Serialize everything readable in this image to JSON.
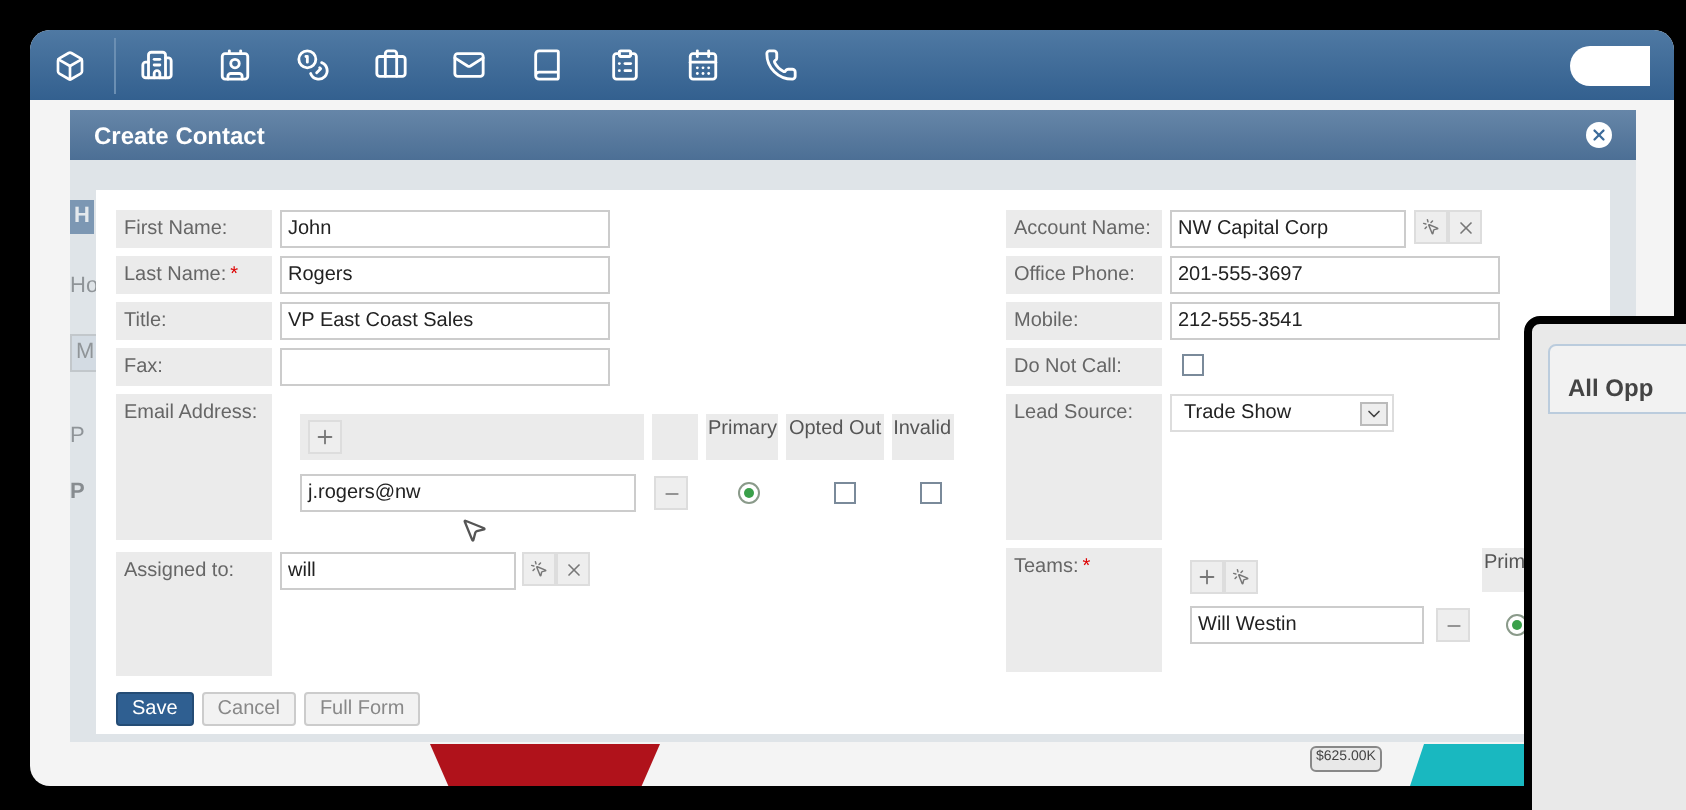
{
  "background": {
    "left_fragments": [
      {
        "text": "H",
        "kind": "tab"
      },
      {
        "text": "Ho",
        "kind": "plain"
      },
      {
        "text": "M",
        "kind": "button"
      },
      {
        "text": "P",
        "kind": "plain"
      },
      {
        "text": "P",
        "kind": "bold"
      }
    ],
    "badge": "$625.00K"
  },
  "dialog": {
    "title": "Create Contact",
    "left_fields": [
      {
        "label": "First Name:",
        "value": "John"
      },
      {
        "label": "Last Name:",
        "value": "Rogers",
        "required_mark": "*"
      },
      {
        "label": "Title:",
        "value": "VP East Coast Sales"
      },
      {
        "label": "Fax:"
      }
    ],
    "email": {
      "label": "Email Address:",
      "columns": [
        "Primary",
        "Opted Out",
        "Invalid"
      ],
      "addresses": [
        {
          "value": "j.rogers@nw",
          "primary": true,
          "opted_out": false,
          "invalid": false
        }
      ]
    },
    "assigned": {
      "label": "Assigned to:",
      "value": "will"
    },
    "account": {
      "label": "Account Name:",
      "value": "NW Capital Corp"
    },
    "phones": [
      {
        "label": "Office Phone:",
        "value": "201-555-3697"
      },
      {
        "label": "Mobile:",
        "value": "212-555-3541"
      }
    ],
    "do_not_call": {
      "label": "Do Not Call:",
      "checked": false
    },
    "lead_source": {
      "label": "Lead Source:",
      "value": "Trade Show"
    },
    "teams": {
      "label": "Teams:",
      "required_mark": "*",
      "column": "Prim",
      "members": [
        {
          "value": "Will Westin",
          "primary": true
        }
      ]
    },
    "buttons": [
      {
        "label": "Save",
        "kind": "primary"
      },
      {
        "label": "Cancel",
        "kind": "secondary"
      },
      {
        "label": "Full Form",
        "kind": "secondary"
      }
    ]
  },
  "overlay_window": {
    "title": "All Opp"
  }
}
